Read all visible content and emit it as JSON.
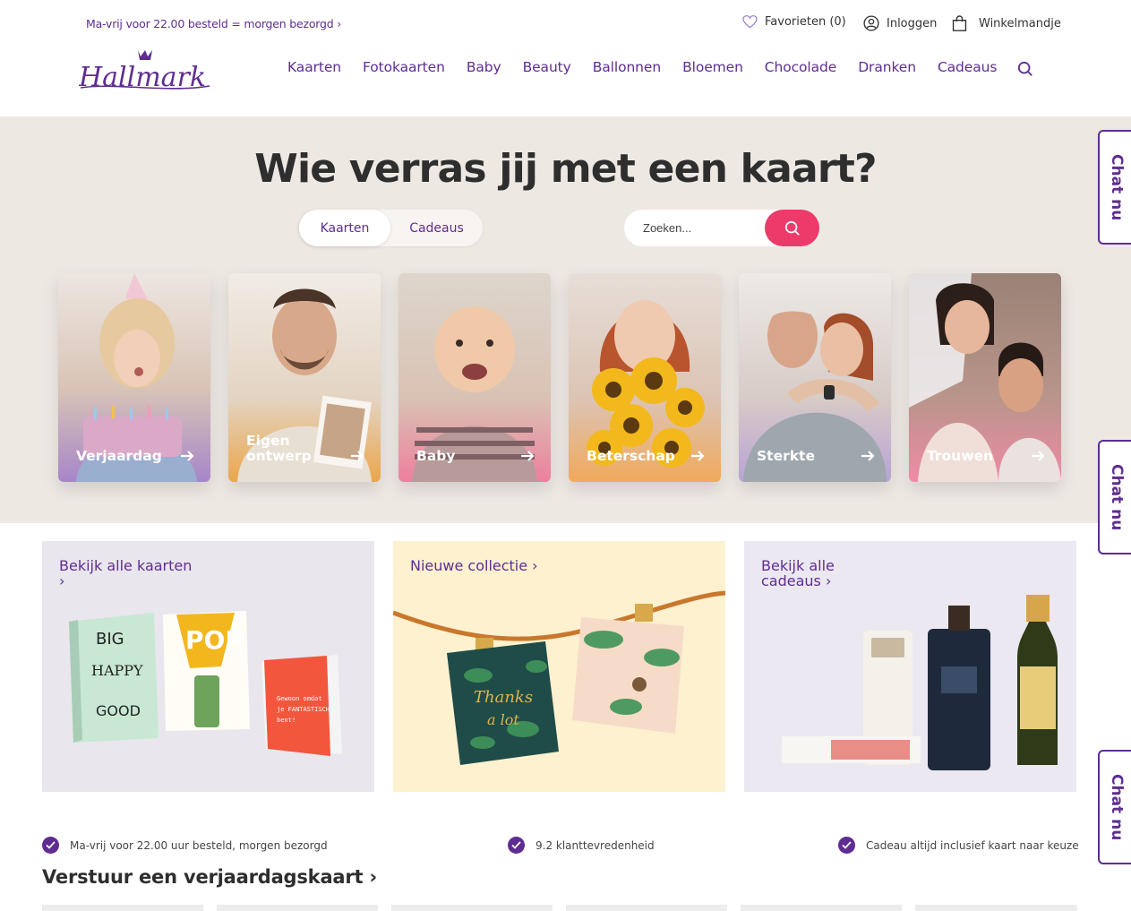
{
  "header": {
    "promo": "Ma-vrij voor 22.00 besteld = morgen bezorgd ›",
    "favorites_label": "Favorieten (0)",
    "login_label": "Inloggen",
    "cart_label": "Winkelmandje",
    "logo_text": "Hallmark",
    "nav": [
      "Kaarten",
      "Fotokaarten",
      "Baby",
      "Beauty",
      "Ballonnen",
      "Bloemen",
      "Chocolade",
      "Dranken",
      "Cadeaus"
    ]
  },
  "hero": {
    "title": "Wie verras jij met een kaart?",
    "toggle": [
      "Kaarten",
      "Cadeaus"
    ],
    "search_placeholder": "Zoeken...",
    "cards": [
      {
        "label": "Verjaardag"
      },
      {
        "label": "Eigen ontwerp"
      },
      {
        "label": "Baby"
      },
      {
        "label": "Beterschap"
      },
      {
        "label": "Sterkte"
      },
      {
        "label": "Trouwen"
      }
    ]
  },
  "tiles": [
    {
      "title": "Bekijk alle kaarten ›"
    },
    {
      "title": "Nieuwe collectie ›"
    },
    {
      "title": "Bekijk alle cadeaus ›"
    }
  ],
  "usps": [
    "Ma-vrij voor 22.00 uur besteld, morgen bezorgd",
    "9.2 klanttevredenheid",
    "Cadeau altijd inclusief kaart naar keuze"
  ],
  "section_title": "Verstuur een verjaardagskaart ›",
  "chat_label": "Chat nu",
  "colors": {
    "brand": "#5f2d91",
    "accent": "#ec3b6a",
    "hero_bg": "#eee8e3"
  }
}
